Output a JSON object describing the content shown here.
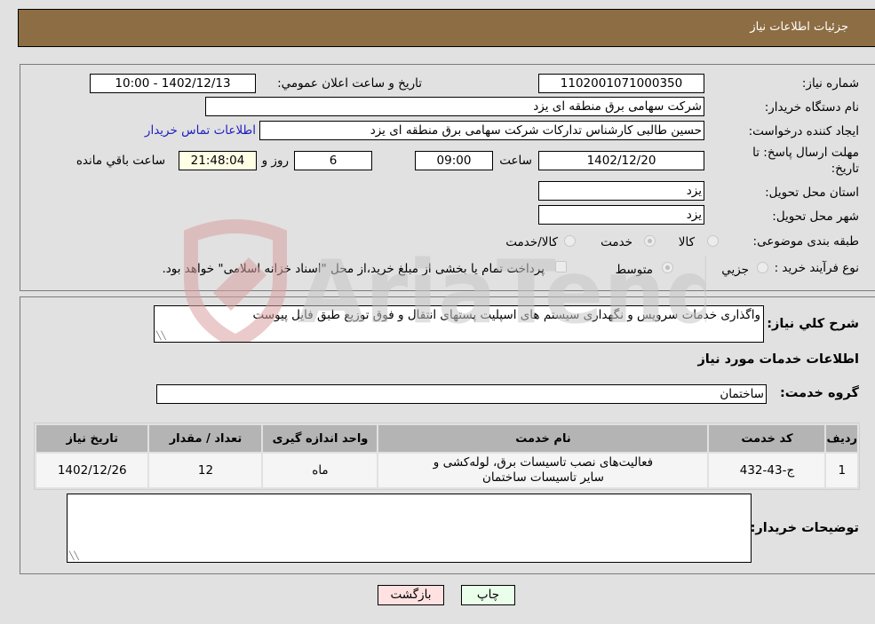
{
  "header": {
    "title": "جزئیات اطلاعات نیاز"
  },
  "fields": {
    "need_number_label": "شماره نیاز:",
    "need_number": "1102001071000350",
    "announce_label": "تاریخ و ساعت اعلان عمومي:",
    "announce_value": "1402/12/13 - 10:00",
    "buyer_org_label": "نام دستگاه خریدار:",
    "buyer_org": "شرکت سهامی برق منطقه ای یزد",
    "creator_label": "ایجاد کننده درخواست:",
    "creator": "حسین طالبی کارشناس تدارکات شرکت سهامی برق منطقه ای یزد",
    "contact_link": "اطلاعات تماس خریدار",
    "deadline_label_1": "مهلت ارسال پاسخ: تا",
    "deadline_label_2": "تاریخ:",
    "deadline_date": "1402/12/20",
    "time_label": "ساعت",
    "deadline_time": "09:00",
    "days_value": "6",
    "days_label": "روز و",
    "remaining_time": "21:48:04",
    "remaining_label": "ساعت باقي مانده",
    "province_label": "استان محل تحویل:",
    "province": "یزد",
    "city_label": "شهر محل تحویل:",
    "city": "یزد",
    "category_label": "طبقه بندی موضوعی:",
    "category_options": [
      {
        "label": "کالا",
        "checked": false
      },
      {
        "label": "خدمت",
        "checked": true
      },
      {
        "label": "کالا/خدمت",
        "checked": false
      }
    ],
    "process_label": "نوع فرآیند خرید :",
    "process_options": [
      {
        "label": "جزیي",
        "checked": false
      },
      {
        "label": "متوسط",
        "checked": true
      }
    ],
    "treasury_note": "پرداخت تمام یا بخشی از مبلغ خرید،از محل \"اسناد خزانه اسلامی\" خواهد بود.",
    "treasury_checked": false
  },
  "details": {
    "description_label": "شرح کلي نیاز:",
    "description": "واگذاری خدمات سرویس و نگهداری سیستم های اسپلیت پستهای انتقال و فوق توزیع طبق فایل پیوست",
    "services_heading": "اطلاعات خدمات مورد نیاز",
    "service_group_label": "گروه خدمت:",
    "service_group": "ساختمان",
    "table": {
      "headers": [
        "ردیف",
        "کد خدمت",
        "نام خدمت",
        "واحد اندازه گیری",
        "تعداد / مقدار",
        "تاریخ نیاز"
      ],
      "rows": [
        [
          "1",
          "ج-43-432",
          "فعالیت‌های نصب تاسیسات برق، لوله‌کشی و سایر تاسیسات ساختمان",
          "ماه",
          "12",
          "1402/12/26"
        ]
      ]
    },
    "buyer_notes_label": "توضیحات خریدار:",
    "buyer_notes": ""
  },
  "buttons": {
    "print": "چاپ",
    "back": "بازگشت"
  },
  "watermark": {
    "text": "AriaTender.neT"
  },
  "colors": {
    "header_bg": "#8d6d43",
    "back_btn": "#ffe1e1",
    "print_btn": "#eaffea",
    "link": "#2020c0"
  }
}
